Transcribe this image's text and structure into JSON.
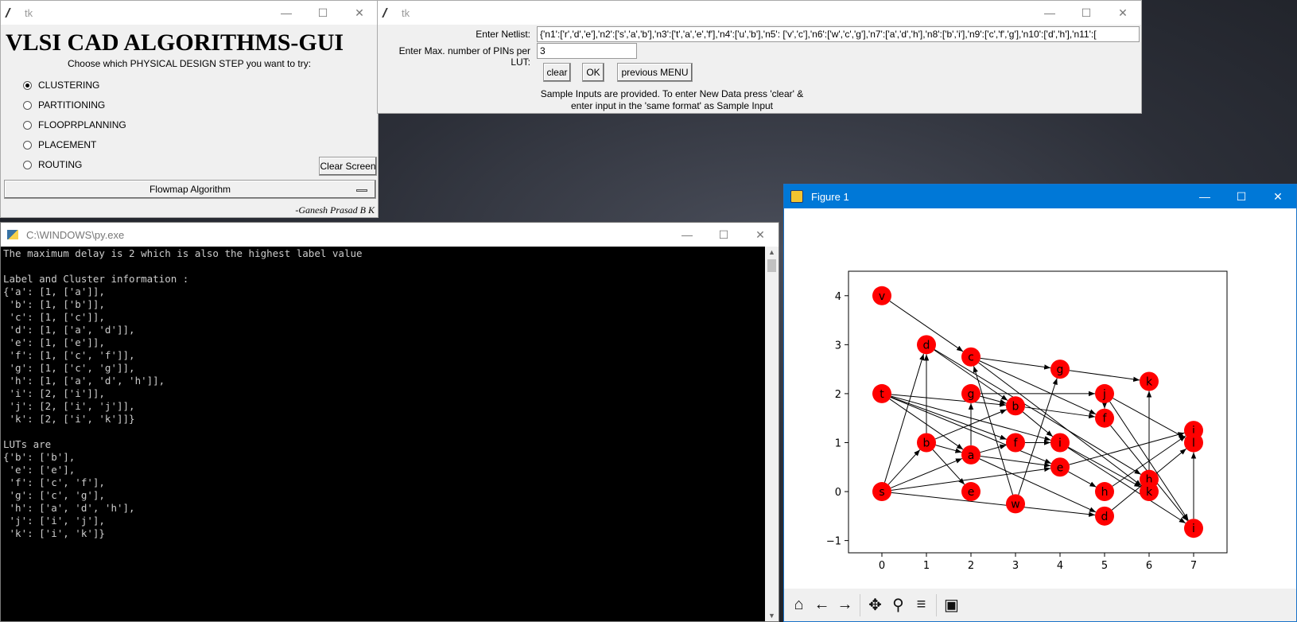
{
  "window1": {
    "title": "tk",
    "heading": "VLSI CAD ALGORITHMS-GUI",
    "prompt": "Choose which PHYSICAL DESIGN STEP you want to try:",
    "options": [
      {
        "label": "CLUSTERING",
        "selected": true
      },
      {
        "label": "PARTITIONING",
        "selected": false
      },
      {
        "label": "FLOOPRPLANNING",
        "selected": false
      },
      {
        "label": "PLACEMENT",
        "selected": false
      },
      {
        "label": "ROUTING",
        "selected": false
      }
    ],
    "clear_screen_label": "Clear Screen",
    "algorithm_menu": "Flowmap Algorithm",
    "signature": "-Ganesh Prasad B K"
  },
  "window2": {
    "title": "tk",
    "netlist_label": "Enter Netlist:",
    "netlist_value": "{'n1':['r','d','e'],'n2':['s','a','b'],'n3':['t','a','e','f'],'n4':['u','b'],'n5': ['v','c'],'n6':['w','c','g'],'n7':['a','d','h'],'n8':['b','i'],'n9':['c','f','g'],'n10':['d','h'],'n11':[",
    "pins_label": "Enter Max. number of PINs per LUT:",
    "pins_value": "3",
    "clear_label": "clear",
    "ok_label": "OK",
    "previous_label": "previous MENU",
    "note_line1": "Sample Inputs are provided. To enter New Data press 'clear' &",
    "note_line2": "enter input in the 'same format' as Sample Input"
  },
  "console": {
    "title": "C:\\WINDOWS\\py.exe",
    "lines": [
      "The maximum delay is 2 which is also the highest label value",
      "",
      "Label and Cluster information :",
      "{'a': [1, ['a']],",
      " 'b': [1, ['b']],",
      " 'c': [1, ['c']],",
      " 'd': [1, ['a', 'd']],",
      " 'e': [1, ['e']],",
      " 'f': [1, ['c', 'f']],",
      " 'g': [1, ['c', 'g']],",
      " 'h': [1, ['a', 'd', 'h']],",
      " 'i': [2, ['i']],",
      " 'j': [2, ['i', 'j']],",
      " 'k': [2, ['i', 'k']]}",
      "",
      "LUTs are",
      "{'b': ['b'],",
      " 'e': ['e'],",
      " 'f': ['c', 'f'],",
      " 'g': ['c', 'g'],",
      " 'h': ['a', 'd', 'h'],",
      " 'j': ['i', 'j'],",
      " 'k': ['i', 'k']}"
    ]
  },
  "figure": {
    "title": "Figure 1",
    "toolbar": [
      "home-icon",
      "back-icon",
      "forward-icon",
      "pan-icon",
      "zoom-icon",
      "configure-icon",
      "save-icon"
    ],
    "node_color": "#ff0000"
  },
  "chart_data": {
    "type": "scatter",
    "xlim": [
      -0.75,
      7.75
    ],
    "ylim": [
      -1.25,
      4.5
    ],
    "xticks": [
      "0",
      "1",
      "2",
      "3",
      "4",
      "5",
      "6",
      "7"
    ],
    "yticks": [
      "−1",
      "0",
      "1",
      "2",
      "3",
      "4"
    ],
    "nodes": [
      {
        "id": "v",
        "x": 0,
        "y": 4
      },
      {
        "id": "t",
        "x": 0,
        "y": 2
      },
      {
        "id": "s",
        "x": 0,
        "y": 0
      },
      {
        "id": "d1",
        "label": "d",
        "x": 1,
        "y": 3
      },
      {
        "id": "b1",
        "label": "b",
        "x": 1,
        "y": 1
      },
      {
        "id": "c",
        "x": 2,
        "y": 2.75
      },
      {
        "id": "g1",
        "label": "g",
        "x": 2,
        "y": 2
      },
      {
        "id": "a",
        "x": 2,
        "y": 0.75
      },
      {
        "id": "e1",
        "label": "e",
        "x": 2,
        "y": 0
      },
      {
        "id": "b2",
        "label": "b",
        "x": 3,
        "y": 1.75
      },
      {
        "id": "f1",
        "label": "f",
        "x": 3,
        "y": 1
      },
      {
        "id": "w",
        "x": 3,
        "y": -0.25
      },
      {
        "id": "g2",
        "label": "g",
        "x": 4,
        "y": 2.5
      },
      {
        "id": "i1",
        "label": "i",
        "x": 4,
        "y": 1
      },
      {
        "id": "e2",
        "label": "e",
        "x": 4,
        "y": 0.5
      },
      {
        "id": "j1",
        "label": "j",
        "x": 5,
        "y": 2
      },
      {
        "id": "f2",
        "label": "f",
        "x": 5,
        "y": 1.5
      },
      {
        "id": "h1",
        "label": "h",
        "x": 5,
        "y": 0
      },
      {
        "id": "d2",
        "label": "d",
        "x": 5,
        "y": -0.5
      },
      {
        "id": "k1",
        "label": "k",
        "x": 6,
        "y": 2.25
      },
      {
        "id": "h2",
        "label": "h",
        "x": 6,
        "y": 0.25
      },
      {
        "id": "k2",
        "label": "k",
        "x": 6,
        "y": 0
      },
      {
        "id": "j2",
        "label": "j",
        "x": 7,
        "y": 1.25
      },
      {
        "id": "l",
        "x": 7,
        "y": 1
      },
      {
        "id": "i2",
        "label": "i",
        "x": 7,
        "y": -0.75
      }
    ],
    "edges": [
      [
        "v",
        "c"
      ],
      [
        "t",
        "b2"
      ],
      [
        "t",
        "i1"
      ],
      [
        "t",
        "e2"
      ],
      [
        "t",
        "f1"
      ],
      [
        "s",
        "d1"
      ],
      [
        "s",
        "a"
      ],
      [
        "s",
        "e2"
      ],
      [
        "s",
        "d2"
      ],
      [
        "s",
        "b1"
      ],
      [
        "d1",
        "b2"
      ],
      [
        "d1",
        "h2"
      ],
      [
        "b1",
        "d1"
      ],
      [
        "b1",
        "e1"
      ],
      [
        "b1",
        "a"
      ],
      [
        "c",
        "g2"
      ],
      [
        "c",
        "f2"
      ],
      [
        "c",
        "k2"
      ],
      [
        "g1",
        "j1"
      ],
      [
        "g1",
        "b2"
      ],
      [
        "a",
        "g1"
      ],
      [
        "a",
        "f1"
      ],
      [
        "a",
        "e2"
      ],
      [
        "a",
        "d2"
      ],
      [
        "b2",
        "f2"
      ],
      [
        "b2",
        "i1"
      ],
      [
        "f1",
        "i1"
      ],
      [
        "w",
        "c"
      ],
      [
        "w",
        "g2"
      ],
      [
        "g2",
        "k1"
      ],
      [
        "i1",
        "i2"
      ],
      [
        "i1",
        "k2"
      ],
      [
        "e2",
        "h1"
      ],
      [
        "e2",
        "j2"
      ],
      [
        "j1",
        "f2"
      ],
      [
        "j1",
        "l"
      ],
      [
        "j1",
        "i2"
      ],
      [
        "f2",
        "i2"
      ],
      [
        "h1",
        "j2"
      ],
      [
        "d2",
        "l"
      ],
      [
        "k2",
        "k1"
      ],
      [
        "i2",
        "l"
      ],
      [
        "t",
        "a"
      ],
      [
        "b1",
        "b2"
      ]
    ]
  }
}
